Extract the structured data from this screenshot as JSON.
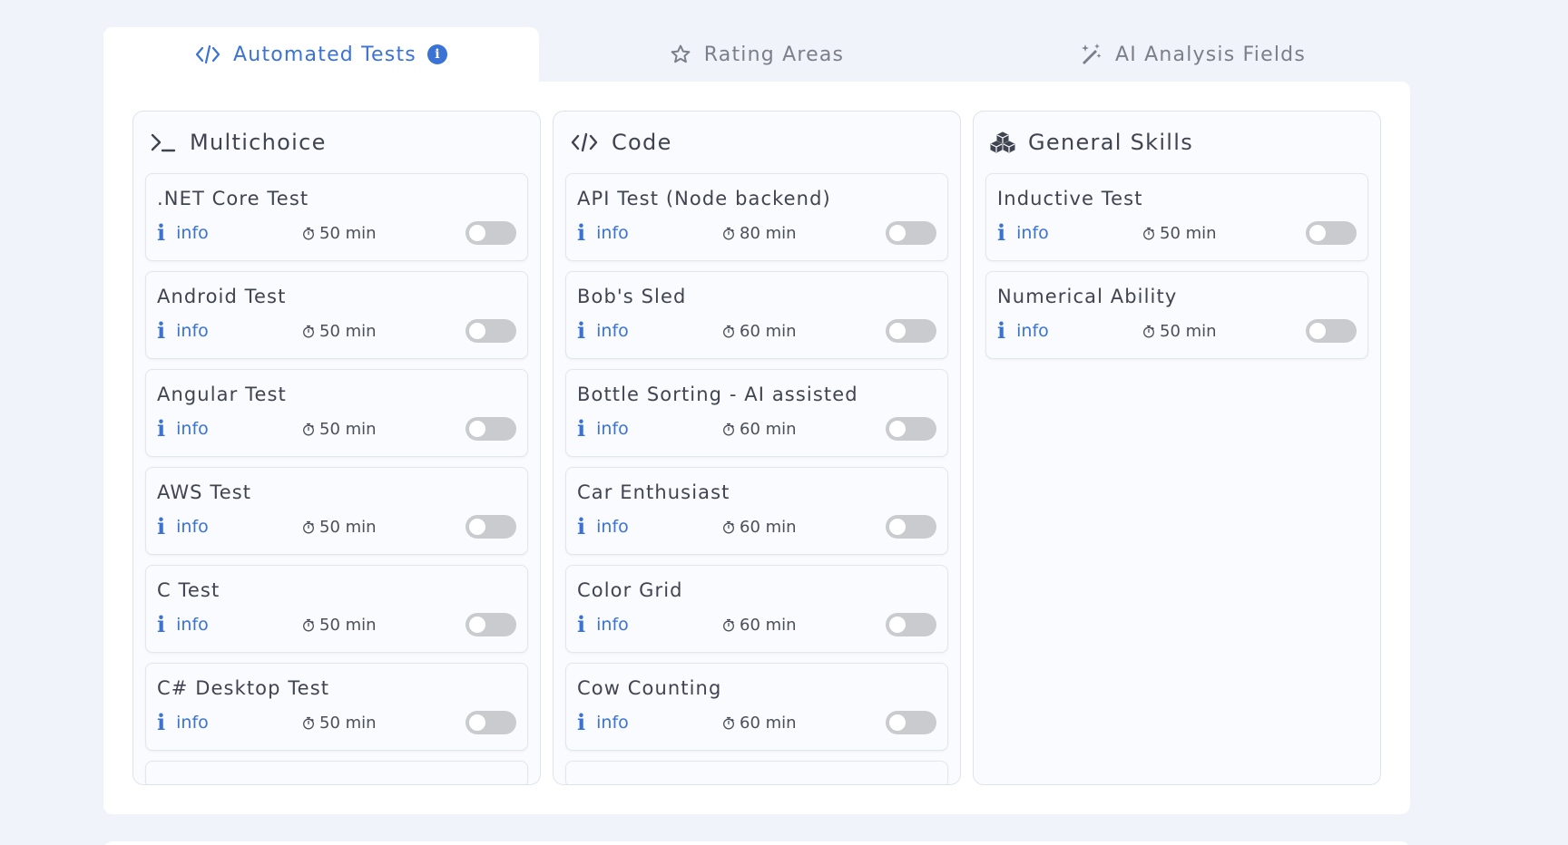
{
  "tabs": [
    {
      "label": "Automated Tests",
      "icon": "code-icon",
      "active": true,
      "badge": "i"
    },
    {
      "label": "Rating Areas",
      "icon": "star-icon",
      "active": false
    },
    {
      "label": "AI Analysis Fields",
      "icon": "magic-wand-icon",
      "active": false
    }
  ],
  "colors": {
    "accent": "#3b73d4",
    "toggle_off": "#c9cbcf",
    "background": "#f0f3fa"
  },
  "columns": [
    {
      "title": "Multichoice",
      "icon": "terminal-icon",
      "cards": [
        {
          "title": ".NET Core Test",
          "info": "info",
          "duration": "50 min",
          "enabled": false
        },
        {
          "title": "Android Test",
          "info": "info",
          "duration": "50 min",
          "enabled": false
        },
        {
          "title": "Angular Test",
          "info": "info",
          "duration": "50 min",
          "enabled": false
        },
        {
          "title": "AWS Test",
          "info": "info",
          "duration": "50 min",
          "enabled": false
        },
        {
          "title": "C Test",
          "info": "info",
          "duration": "50 min",
          "enabled": false
        },
        {
          "title": "C# Desktop Test",
          "info": "info",
          "duration": "50 min",
          "enabled": false
        }
      ]
    },
    {
      "title": "Code",
      "icon": "code-icon",
      "cards": [
        {
          "title": "API Test (Node backend)",
          "info": "info",
          "duration": "80 min",
          "enabled": false
        },
        {
          "title": "Bob's Sled",
          "info": "info",
          "duration": "60 min",
          "enabled": false
        },
        {
          "title": "Bottle Sorting - AI assisted",
          "info": "info",
          "duration": "60 min",
          "enabled": false
        },
        {
          "title": "Car Enthusiast",
          "info": "info",
          "duration": "60 min",
          "enabled": false
        },
        {
          "title": "Color Grid",
          "info": "info",
          "duration": "60 min",
          "enabled": false
        },
        {
          "title": "Cow Counting",
          "info": "info",
          "duration": "60 min",
          "enabled": false
        }
      ]
    },
    {
      "title": "General Skills",
      "icon": "cubes-icon",
      "cards": [
        {
          "title": "Inductive Test",
          "info": "info",
          "duration": "50 min",
          "enabled": false
        },
        {
          "title": "Numerical Ability",
          "info": "info",
          "duration": "50 min",
          "enabled": false
        }
      ]
    }
  ]
}
